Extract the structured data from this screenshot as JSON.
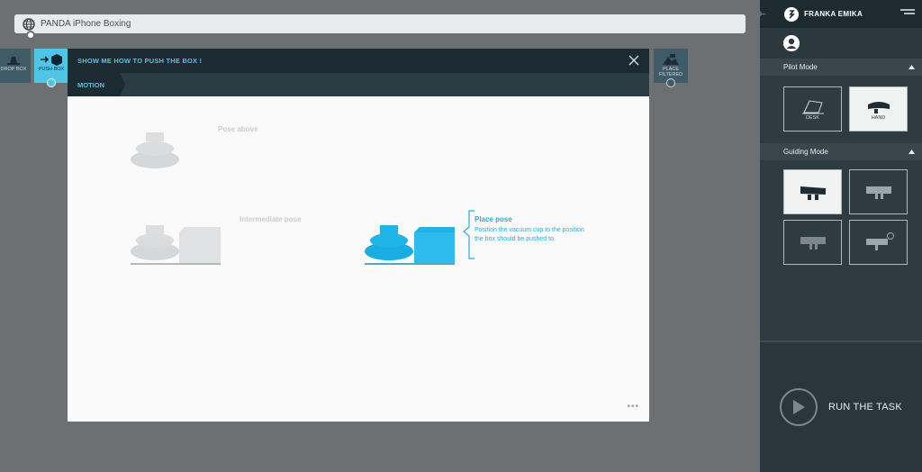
{
  "taskbar": {
    "title": "PANDA iPhone Boxing"
  },
  "apps": {
    "drop_box": "DROP BOX",
    "push_box": "PUSH BOX",
    "place_filtered": "PLACE FILTERED"
  },
  "dialog": {
    "title": "SHOW ME HOW TO PUSH THE BOX !",
    "tab": "MOTION",
    "pose_above": "Pose above",
    "intermediate_pose": "Intermediate pose",
    "place_pose": "Place pose",
    "place_desc": "Position the vacuum cup to the position the box should be pushed to.",
    "more": "•••"
  },
  "sidebar": {
    "brand": "FRANKA EMIKA",
    "pilot_mode": "Pilot Mode",
    "pilot_options": [
      {
        "label": "DESK"
      },
      {
        "label": "HAND"
      }
    ],
    "guiding_mode": "Guiding Mode",
    "run_label": "RUN THE TASK"
  },
  "colors": {
    "accent": "#4fc6e6",
    "place": "#27aee0",
    "dark": "#1c2a31"
  }
}
